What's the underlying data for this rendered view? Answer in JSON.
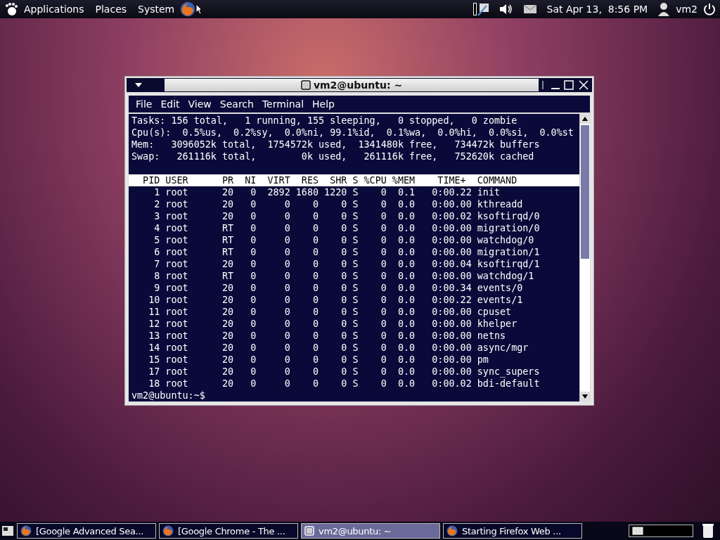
{
  "top_panel": {
    "menus": [
      "Applications",
      "Places",
      "System"
    ],
    "clock": "Sat Apr 13,  8:56 PM",
    "user": "vm2"
  },
  "window": {
    "title": "vm2@ubuntu: ~",
    "menu": [
      "File",
      "Edit",
      "View",
      "Search",
      "Terminal",
      "Help"
    ],
    "summary": [
      "Tasks: 156 total,   1 running, 155 sleeping,   0 stopped,   0 zombie",
      "Cpu(s):  0.5%us,  0.2%sy,  0.0%ni, 99.1%id,  0.1%wa,  0.0%hi,  0.0%si,  0.0%st",
      "Mem:   3096052k total,  1754572k used,  1341480k free,   734472k buffers",
      "Swap:   261116k total,        0k used,   261116k free,   752620k cached"
    ],
    "header": "  PID USER      PR  NI  VIRT  RES  SHR S %CPU %MEM    TIME+  COMMAND",
    "processes": [
      "    1 root      20   0  2892 1680 1220 S    0  0.1   0:00.22 init",
      "    2 root      20   0     0    0    0 S    0  0.0   0:00.00 kthreadd",
      "    3 root      20   0     0    0    0 S    0  0.0   0:00.02 ksoftirqd/0",
      "    4 root      RT   0     0    0    0 S    0  0.0   0:00.00 migration/0",
      "    5 root      RT   0     0    0    0 S    0  0.0   0:00.00 watchdog/0",
      "    6 root      RT   0     0    0    0 S    0  0.0   0:00.00 migration/1",
      "    7 root      20   0     0    0    0 S    0  0.0   0:00.04 ksoftirqd/1",
      "    8 root      RT   0     0    0    0 S    0  0.0   0:00.00 watchdog/1",
      "    9 root      20   0     0    0    0 S    0  0.0   0:00.34 events/0",
      "   10 root      20   0     0    0    0 S    0  0.0   0:00.22 events/1",
      "   11 root      20   0     0    0    0 S    0  0.0   0:00.00 cpuset",
      "   12 root      20   0     0    0    0 S    0  0.0   0:00.00 khelper",
      "   13 root      20   0     0    0    0 S    0  0.0   0:00.00 netns",
      "   14 root      20   0     0    0    0 S    0  0.0   0:00.00 async/mgr",
      "   15 root      20   0     0    0    0 S    0  0.0   0:00.00 pm",
      "   17 root      20   0     0    0    0 S    0  0.0   0:00.00 sync_supers",
      "   18 root      20   0     0    0    0 S    0  0.0   0:00.02 bdi-default"
    ],
    "prompt": "vm2@ubuntu:~$"
  },
  "taskbar": [
    {
      "label": "[Google Advanced Sea...",
      "kind": "browser",
      "selected": false
    },
    {
      "label": "[Google Chrome - The ...",
      "kind": "browser",
      "selected": false
    },
    {
      "label": "vm2@ubuntu: ~",
      "kind": "terminal",
      "selected": true
    },
    {
      "label": "Starting Firefox Web ...",
      "kind": "browser",
      "selected": false
    }
  ]
}
